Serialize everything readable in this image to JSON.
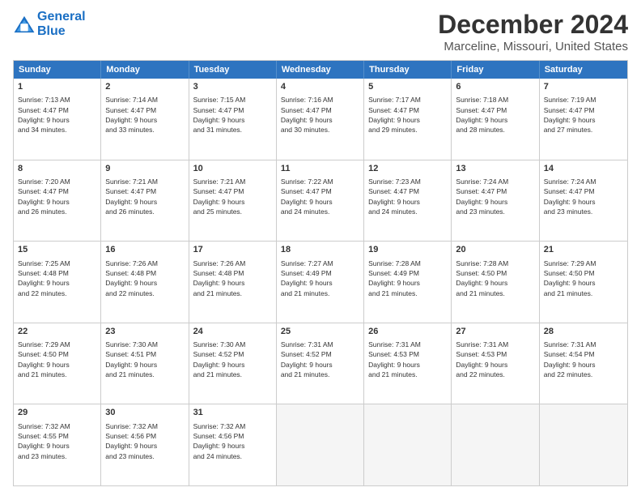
{
  "header": {
    "logo_line1": "General",
    "logo_line2": "Blue",
    "title": "December 2024",
    "subtitle": "Marceline, Missouri, United States"
  },
  "calendar": {
    "days_of_week": [
      "Sunday",
      "Monday",
      "Tuesday",
      "Wednesday",
      "Thursday",
      "Friday",
      "Saturday"
    ],
    "weeks": [
      [
        {
          "day": "",
          "info": ""
        },
        {
          "day": "2",
          "info": "Sunrise: 7:14 AM\nSunset: 4:47 PM\nDaylight: 9 hours\nand 33 minutes."
        },
        {
          "day": "3",
          "info": "Sunrise: 7:15 AM\nSunset: 4:47 PM\nDaylight: 9 hours\nand 31 minutes."
        },
        {
          "day": "4",
          "info": "Sunrise: 7:16 AM\nSunset: 4:47 PM\nDaylight: 9 hours\nand 30 minutes."
        },
        {
          "day": "5",
          "info": "Sunrise: 7:17 AM\nSunset: 4:47 PM\nDaylight: 9 hours\nand 29 minutes."
        },
        {
          "day": "6",
          "info": "Sunrise: 7:18 AM\nSunset: 4:47 PM\nDaylight: 9 hours\nand 28 minutes."
        },
        {
          "day": "7",
          "info": "Sunrise: 7:19 AM\nSunset: 4:47 PM\nDaylight: 9 hours\nand 27 minutes."
        }
      ],
      [
        {
          "day": "1",
          "info": "Sunrise: 7:13 AM\nSunset: 4:47 PM\nDaylight: 9 hours\nand 34 minutes."
        },
        {
          "day": "",
          "info": ""
        },
        {
          "day": "",
          "info": ""
        },
        {
          "day": "",
          "info": ""
        },
        {
          "day": "",
          "info": ""
        },
        {
          "day": "",
          "info": ""
        },
        {
          "day": "",
          "info": ""
        }
      ],
      [
        {
          "day": "8",
          "info": "Sunrise: 7:20 AM\nSunset: 4:47 PM\nDaylight: 9 hours\nand 26 minutes."
        },
        {
          "day": "9",
          "info": "Sunrise: 7:21 AM\nSunset: 4:47 PM\nDaylight: 9 hours\nand 26 minutes."
        },
        {
          "day": "10",
          "info": "Sunrise: 7:21 AM\nSunset: 4:47 PM\nDaylight: 9 hours\nand 25 minutes."
        },
        {
          "day": "11",
          "info": "Sunrise: 7:22 AM\nSunset: 4:47 PM\nDaylight: 9 hours\nand 24 minutes."
        },
        {
          "day": "12",
          "info": "Sunrise: 7:23 AM\nSunset: 4:47 PM\nDaylight: 9 hours\nand 24 minutes."
        },
        {
          "day": "13",
          "info": "Sunrise: 7:24 AM\nSunset: 4:47 PM\nDaylight: 9 hours\nand 23 minutes."
        },
        {
          "day": "14",
          "info": "Sunrise: 7:24 AM\nSunset: 4:47 PM\nDaylight: 9 hours\nand 23 minutes."
        }
      ],
      [
        {
          "day": "15",
          "info": "Sunrise: 7:25 AM\nSunset: 4:48 PM\nDaylight: 9 hours\nand 22 minutes."
        },
        {
          "day": "16",
          "info": "Sunrise: 7:26 AM\nSunset: 4:48 PM\nDaylight: 9 hours\nand 22 minutes."
        },
        {
          "day": "17",
          "info": "Sunrise: 7:26 AM\nSunset: 4:48 PM\nDaylight: 9 hours\nand 21 minutes."
        },
        {
          "day": "18",
          "info": "Sunrise: 7:27 AM\nSunset: 4:49 PM\nDaylight: 9 hours\nand 21 minutes."
        },
        {
          "day": "19",
          "info": "Sunrise: 7:28 AM\nSunset: 4:49 PM\nDaylight: 9 hours\nand 21 minutes."
        },
        {
          "day": "20",
          "info": "Sunrise: 7:28 AM\nSunset: 4:50 PM\nDaylight: 9 hours\nand 21 minutes."
        },
        {
          "day": "21",
          "info": "Sunrise: 7:29 AM\nSunset: 4:50 PM\nDaylight: 9 hours\nand 21 minutes."
        }
      ],
      [
        {
          "day": "22",
          "info": "Sunrise: 7:29 AM\nSunset: 4:50 PM\nDaylight: 9 hours\nand 21 minutes."
        },
        {
          "day": "23",
          "info": "Sunrise: 7:30 AM\nSunset: 4:51 PM\nDaylight: 9 hours\nand 21 minutes."
        },
        {
          "day": "24",
          "info": "Sunrise: 7:30 AM\nSunset: 4:52 PM\nDaylight: 9 hours\nand 21 minutes."
        },
        {
          "day": "25",
          "info": "Sunrise: 7:31 AM\nSunset: 4:52 PM\nDaylight: 9 hours\nand 21 minutes."
        },
        {
          "day": "26",
          "info": "Sunrise: 7:31 AM\nSunset: 4:53 PM\nDaylight: 9 hours\nand 21 minutes."
        },
        {
          "day": "27",
          "info": "Sunrise: 7:31 AM\nSunset: 4:53 PM\nDaylight: 9 hours\nand 22 minutes."
        },
        {
          "day": "28",
          "info": "Sunrise: 7:31 AM\nSunset: 4:54 PM\nDaylight: 9 hours\nand 22 minutes."
        }
      ],
      [
        {
          "day": "29",
          "info": "Sunrise: 7:32 AM\nSunset: 4:55 PM\nDaylight: 9 hours\nand 23 minutes."
        },
        {
          "day": "30",
          "info": "Sunrise: 7:32 AM\nSunset: 4:56 PM\nDaylight: 9 hours\nand 23 minutes."
        },
        {
          "day": "31",
          "info": "Sunrise: 7:32 AM\nSunset: 4:56 PM\nDaylight: 9 hours\nand 24 minutes."
        },
        {
          "day": "",
          "info": ""
        },
        {
          "day": "",
          "info": ""
        },
        {
          "day": "",
          "info": ""
        },
        {
          "day": "",
          "info": ""
        }
      ]
    ]
  }
}
